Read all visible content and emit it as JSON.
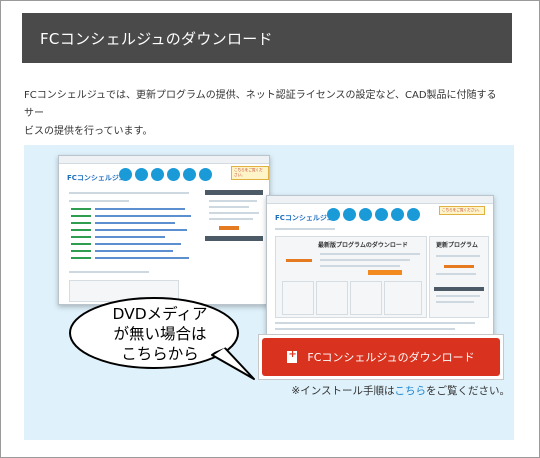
{
  "header": {
    "title": "FCコンシェルジュのダウンロード"
  },
  "description": {
    "line1": "FCコンシェルジュでは、更新プログラムの提供、ネット認証ライセンスの設定など、CAD製品に付随するサー",
    "line2": "ビスの提供を行っています。"
  },
  "screens": {
    "logo": "FCコンシェルジュ",
    "badge": "こちらをご覧ください。",
    "window2_title": "最新版プログラムのダウンロード",
    "window2_side": "更新プログラム"
  },
  "bubble": {
    "line1": "DVDメディア",
    "line2": "が無い場合は",
    "line3": "こちらから"
  },
  "download_button": {
    "label": "FCコンシェルジュのダウンロード"
  },
  "install_note": {
    "prefix": "※インストール手順は",
    "link": "こちら",
    "suffix": "をご覧ください。"
  },
  "colors": {
    "header_bg": "#4a4a4a",
    "panel_bg": "#dff1fb",
    "button_red": "#d9321f",
    "link_blue": "#1b85d1"
  }
}
